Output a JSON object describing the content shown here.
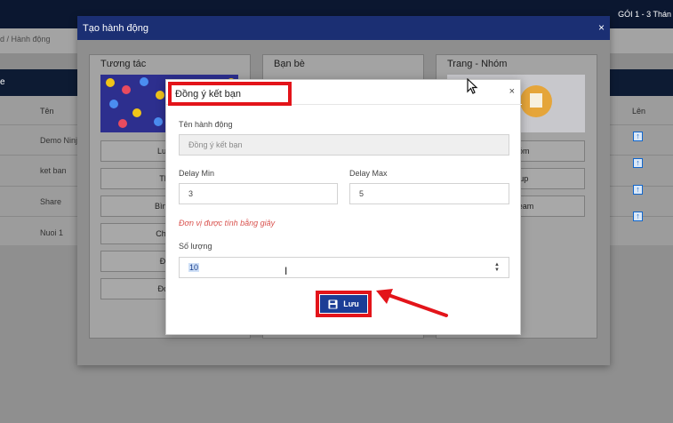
{
  "background": {
    "plan_text": "GÓI 1 - 3 Thán",
    "breadcrumb": "d  /  Hành động",
    "table_bar_letter": "e",
    "columns": {
      "name": "Tên",
      "up": "Lên"
    },
    "rows": [
      "Demo Ninja",
      "ket ban",
      "Share",
      "Nuoi 1"
    ]
  },
  "modal": {
    "title": "Tạo hành động",
    "close_glyph": "×",
    "columns": [
      {
        "title": "Tương tác",
        "buttons": [
          "Lướt n",
          "Thích",
          "Bình luậ",
          "Chia sẻ",
          "Đăng",
          "Đọc th"
        ]
      },
      {
        "title": "Bạn bè",
        "buttons": []
      },
      {
        "title": "Trang - Nhóm",
        "buttons": [
          "a nhóm",
          "i group",
          "ve stream"
        ]
      }
    ]
  },
  "dialog": {
    "title": "Đồng ý kết bạn",
    "close_glyph": "×",
    "action_name_label": "Tên hành động",
    "action_name_value": "Đồng ý kết bạn",
    "delay_min_label": "Delay Min",
    "delay_min_value": "3",
    "delay_max_label": "Delay Max",
    "delay_max_value": "5",
    "unit_note": "Đơn vị được tính bằng giây",
    "quantity_label": "Số lượng",
    "quantity_value": "10",
    "save_label": "Lưu"
  },
  "colors": {
    "header_navy": "#1b2f73",
    "save_blue": "#1b3d96",
    "highlight_red": "#e3141a",
    "note_red": "#d9534f"
  }
}
